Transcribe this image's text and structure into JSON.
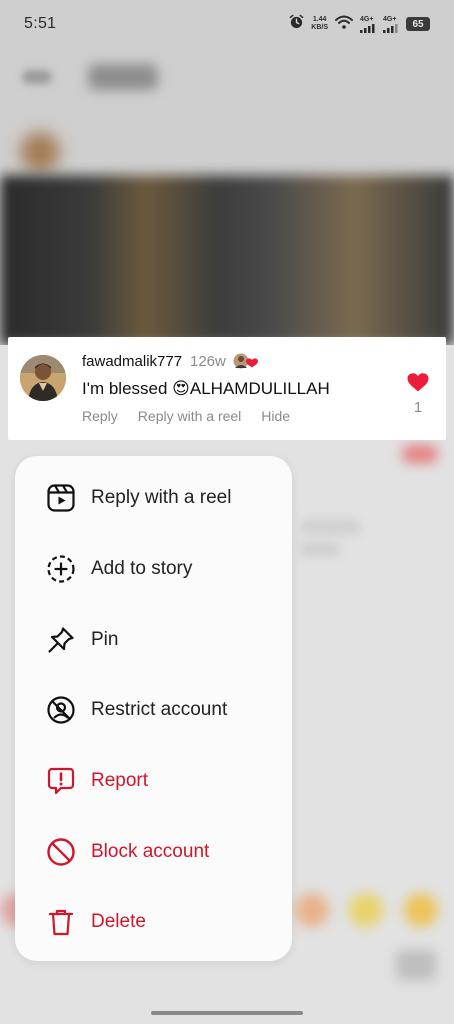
{
  "status_bar": {
    "time": "5:51",
    "net_speed_value": "1.44",
    "net_speed_unit": "KB/S",
    "sim1_label": "4G+",
    "sim2_label": "4G+",
    "battery": "65",
    "icons": [
      "alarm-icon",
      "wifi-icon",
      "signal-icon",
      "battery-icon"
    ]
  },
  "comment": {
    "username": "fawadmalik777",
    "time": "126w",
    "text": "I'm blessed 😍ALHAMDULILLAH",
    "actions": {
      "reply": "Reply",
      "reply_with_reel": "Reply with a reel",
      "hide": "Hide"
    },
    "like_count": "1",
    "like_color": "#ed1c3a"
  },
  "menu": {
    "items": [
      {
        "label": "Reply with a reel",
        "icon": "reel-icon",
        "danger": false
      },
      {
        "label": "Add to story",
        "icon": "add-to-story-icon",
        "danger": false
      },
      {
        "label": "Pin",
        "icon": "pin-icon",
        "danger": false
      },
      {
        "label": "Restrict account",
        "icon": "restrict-icon",
        "danger": false
      },
      {
        "label": "Report",
        "icon": "report-icon",
        "danger": true
      },
      {
        "label": "Block account",
        "icon": "block-icon",
        "danger": true
      },
      {
        "label": "Delete",
        "icon": "trash-icon",
        "danger": true
      }
    ],
    "danger_color": "#d0162b"
  }
}
